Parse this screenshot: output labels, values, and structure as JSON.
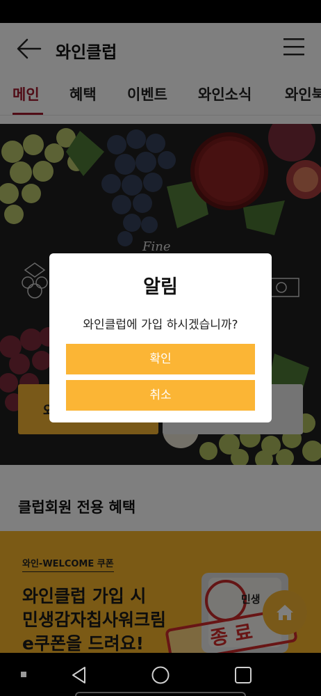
{
  "app": {
    "title": "와인클럽"
  },
  "tabs": [
    {
      "label": "메인",
      "active": true
    },
    {
      "label": "혜택",
      "active": false
    },
    {
      "label": "이벤트",
      "active": false
    },
    {
      "label": "와인소식",
      "active": false
    },
    {
      "label": "와인북",
      "active": false
    }
  ],
  "hero": {
    "left_button_label": "와",
    "logo_text": "Fine"
  },
  "section": {
    "title": "클럽회원 전용 혜택"
  },
  "promo": {
    "badge": "와인-WELCOME 쿠폰",
    "lines": [
      "와인클럽 가입 시",
      "민생감자칩사워크림",
      "e쿠폰을 드려요!"
    ],
    "product_text": "민생",
    "stamp": "종 료"
  },
  "dialog": {
    "title": "알림",
    "message": "와인클럽에 가입 하시겠습니까?",
    "confirm_label": "확인",
    "cancel_label": "취소"
  },
  "colors": {
    "accent": "#a0192d",
    "dialog_button": "#fbb535",
    "promo_bg": "#f7b52b",
    "stamp": "#d12a2a"
  },
  "icons": {
    "back": "back-arrow-icon",
    "menu": "hamburger-menu-icon",
    "home": "home-icon"
  }
}
